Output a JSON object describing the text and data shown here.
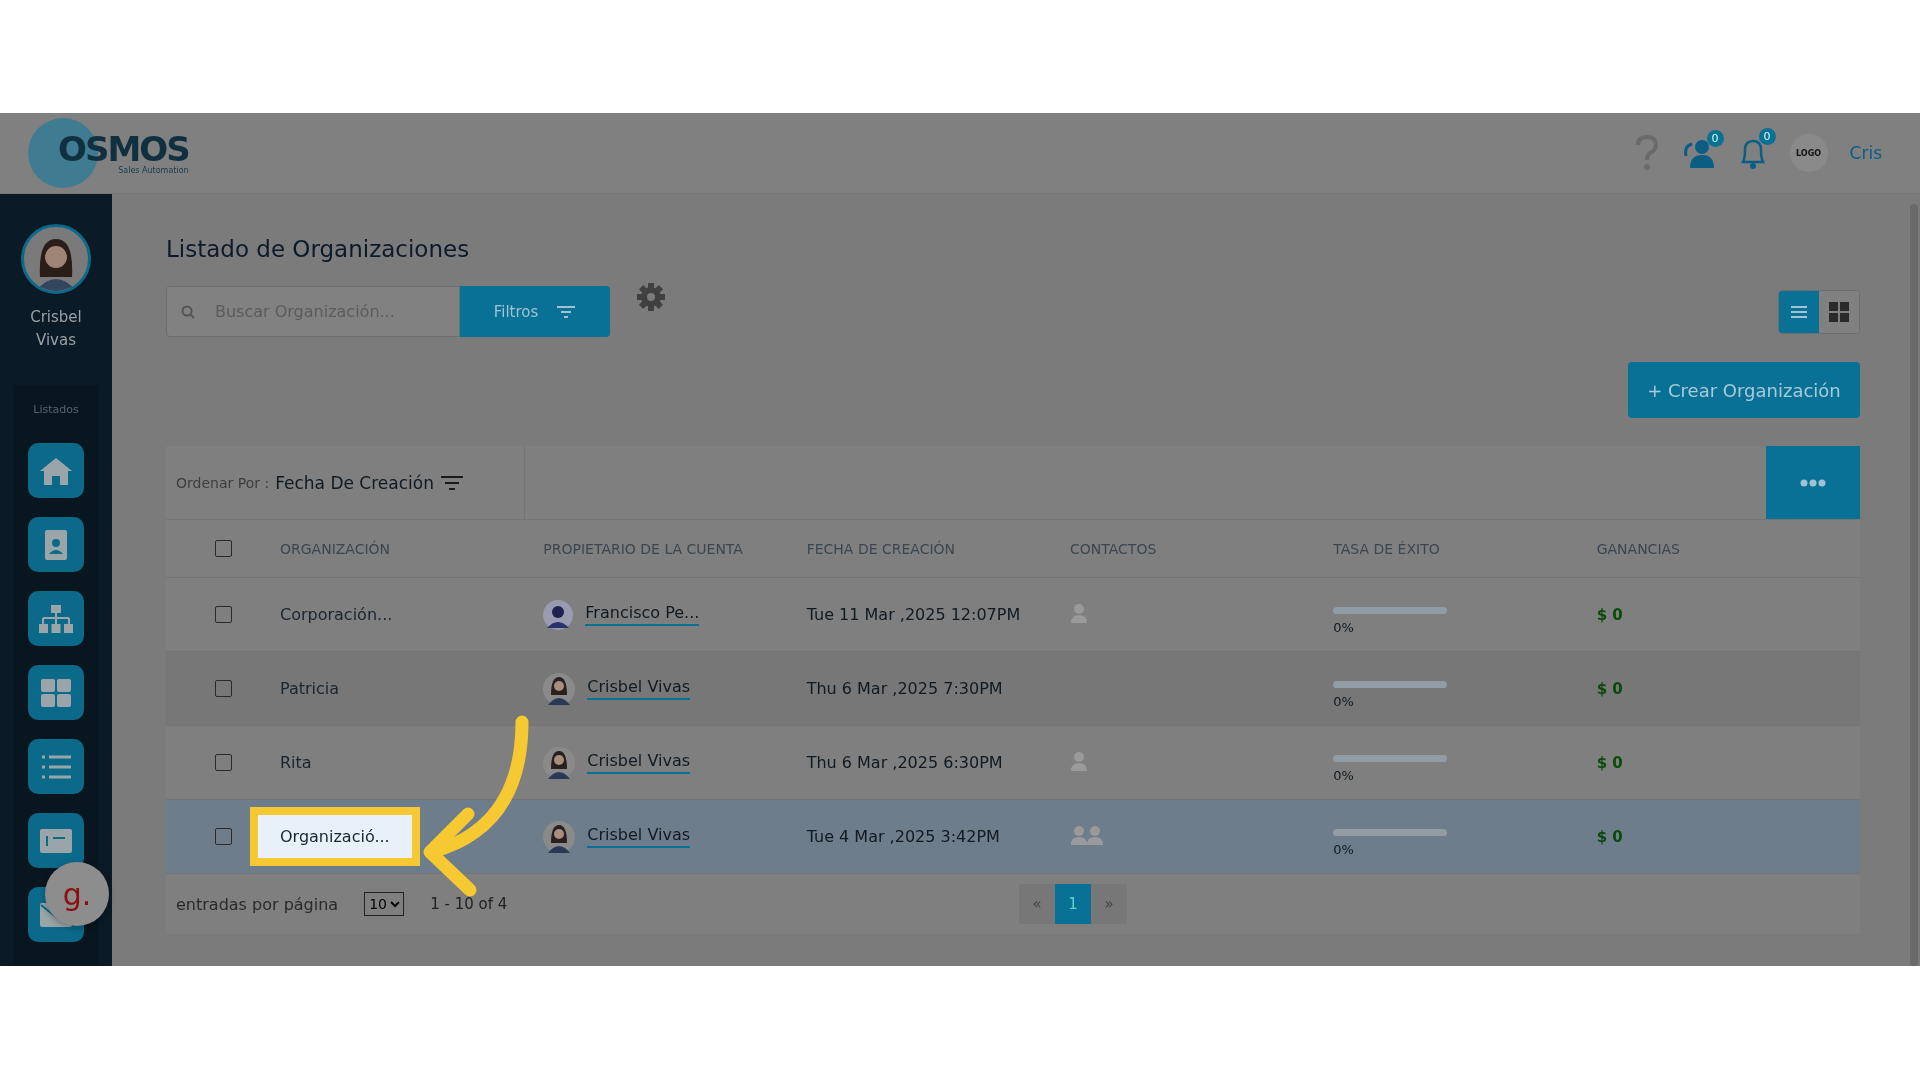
{
  "header": {
    "logo": "OSMOS",
    "logo_tagline": "Sales Automation",
    "chat_badge": "0",
    "bell_badge": "0",
    "company_logo": "LOGO",
    "user": "Cris"
  },
  "sidebar": {
    "user_name": "Crisbel Vivas",
    "section": "Listados",
    "items": [
      {
        "kind": "home"
      },
      {
        "kind": "contact"
      },
      {
        "kind": "org"
      },
      {
        "kind": "grid"
      },
      {
        "kind": "list"
      },
      {
        "kind": "invoice"
      },
      {
        "kind": "mail"
      }
    ]
  },
  "helper_bubble": "g.",
  "page": {
    "title": "Listado de Organizaciones",
    "search": {
      "placeholder": "Buscar Organización..."
    },
    "filter_button": "Filtros",
    "views": [
      {
        "kind": "list",
        "selected": true
      },
      {
        "kind": "grid",
        "selected": false
      }
    ],
    "create_button": "+ Crear Organización",
    "sort_label": "Ordenar Por :",
    "sort_value": "Fecha De Creación"
  },
  "table": {
    "columns": [
      "ORGANIZACIÓN",
      "PROPIETARIO DE LA CUENTA",
      "FECHA DE CREACIÓN",
      "CONTACTOS",
      "TASA DE ÉXITO",
      "GANANCIAS"
    ],
    "header_checked": false,
    "rows": [
      {
        "checked": false,
        "selected": false,
        "spotlight": false,
        "organization": "Corporación...",
        "owner": "Francisco Pe...",
        "owner_avatar": {
          "kind": "man"
        },
        "created": "Tue 11 Mar ,2025 12:07PM",
        "contacts": {
          "kind": "single"
        },
        "level": 0,
        "rate": "0%",
        "earnings": "$ 0"
      },
      {
        "checked": false,
        "selected": false,
        "spotlight": false,
        "organization": "Patricia",
        "owner": "Crisbel Vivas",
        "owner_avatar": {
          "kind": "woman"
        },
        "created": "Thu 6 Mar ,2025 7:30PM",
        "level": 0,
        "rate": "0%",
        "earnings": "$ 0"
      },
      {
        "checked": false,
        "selected": false,
        "spotlight": false,
        "organization": "Rita",
        "owner": "Crisbel Vivas",
        "owner_avatar": {
          "kind": "woman"
        },
        "created": "Thu 6 Mar ,2025 6:30PM",
        "contacts": {
          "kind": "single"
        },
        "level": 0,
        "rate": "0%",
        "earnings": "$ 0"
      },
      {
        "checked": false,
        "selected": true,
        "spotlight": true,
        "organization": "Organizació...",
        "owner": "Crisbel Vivas",
        "owner_avatar": {
          "kind": "woman"
        },
        "created": "Tue 4 Mar ,2025 3:42PM",
        "contacts": {
          "kind": "group"
        },
        "level": 0,
        "rate": "0%",
        "earnings": "$ 0"
      }
    ]
  },
  "footer": {
    "per_page_label": "entradas por página",
    "per_page": "10",
    "range": "1 - 10 of 4",
    "pages": [
      {
        "label": "«",
        "selected": false
      },
      {
        "label": "1",
        "selected": true
      },
      {
        "label": "»",
        "selected": false
      }
    ]
  }
}
